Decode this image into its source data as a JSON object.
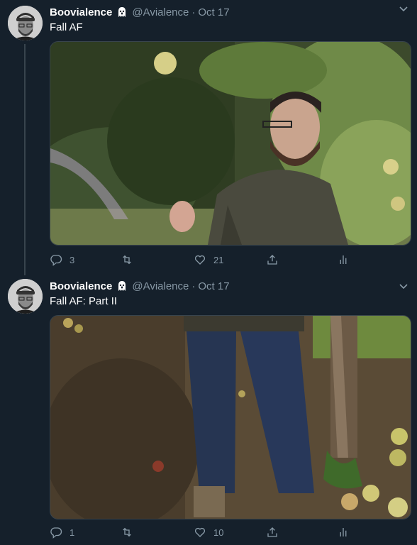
{
  "tweets": [
    {
      "name": "Boovialence",
      "name_icon": "ghost-emoji",
      "handle": "@Avialence",
      "separator": "·",
      "date": "Oct 17",
      "text": "Fall AF",
      "media": "photo-man-tossing-apple",
      "replies": "3",
      "retweets": "",
      "likes": "21"
    },
    {
      "name": "Boovialence",
      "name_icon": "ghost-emoji",
      "handle": "@Avialence",
      "separator": "·",
      "date": "Oct 17",
      "text": "Fall AF: Part II",
      "media": "photo-legs-apple-orchard",
      "replies": "1",
      "retweets": "",
      "likes": "10"
    }
  ],
  "colors": {
    "background": "#15202b",
    "secondary_text": "#8899a6",
    "border": "#38444d"
  },
  "icons": [
    "reply-icon",
    "retweet-icon",
    "like-icon",
    "share-icon",
    "analytics-icon",
    "caret-down-icon"
  ]
}
